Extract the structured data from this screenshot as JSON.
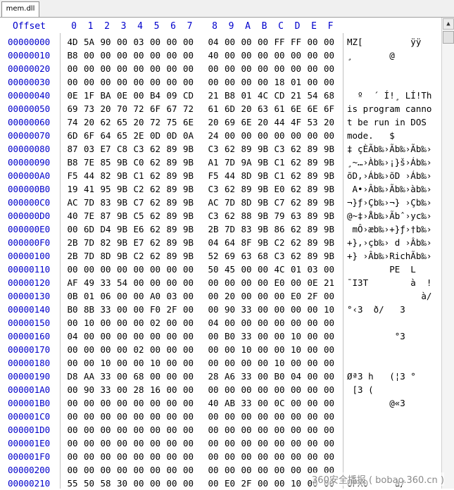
{
  "tab": {
    "label": "mem.dll"
  },
  "header": {
    "offset_label": "Offset",
    "columns": [
      "0",
      "1",
      "2",
      "3",
      "4",
      "5",
      "6",
      "7",
      "8",
      "9",
      "A",
      "B",
      "C",
      "D",
      "E",
      "F"
    ]
  },
  "rows": [
    {
      "offset": "00000000",
      "bytes": [
        "4D",
        "5A",
        "90",
        "00",
        "03",
        "00",
        "00",
        "00",
        "04",
        "00",
        "00",
        "00",
        "FF",
        "FF",
        "00",
        "00"
      ],
      "ascii": "MZ[         ÿÿ"
    },
    {
      "offset": "00000010",
      "bytes": [
        "B8",
        "00",
        "00",
        "00",
        "00",
        "00",
        "00",
        "00",
        "40",
        "00",
        "00",
        "00",
        "00",
        "00",
        "00",
        "00"
      ],
      "ascii": "¸       @"
    },
    {
      "offset": "00000020",
      "bytes": [
        "00",
        "00",
        "00",
        "00",
        "00",
        "00",
        "00",
        "00",
        "00",
        "00",
        "00",
        "00",
        "00",
        "00",
        "00",
        "00"
      ],
      "ascii": ""
    },
    {
      "offset": "00000030",
      "bytes": [
        "00",
        "00",
        "00",
        "00",
        "00",
        "00",
        "00",
        "00",
        "00",
        "00",
        "00",
        "00",
        "18",
        "01",
        "00",
        "00"
      ],
      "ascii": ""
    },
    {
      "offset": "00000040",
      "bytes": [
        "0E",
        "1F",
        "BA",
        "0E",
        "00",
        "B4",
        "09",
        "CD",
        "21",
        "B8",
        "01",
        "4C",
        "CD",
        "21",
        "54",
        "68"
      ],
      "ascii": "  º  ´ Í!¸ LÍ!Th"
    },
    {
      "offset": "00000050",
      "bytes": [
        "69",
        "73",
        "20",
        "70",
        "72",
        "6F",
        "67",
        "72",
        "61",
        "6D",
        "20",
        "63",
        "61",
        "6E",
        "6E",
        "6F"
      ],
      "ascii": "is program canno"
    },
    {
      "offset": "00000060",
      "bytes": [
        "74",
        "20",
        "62",
        "65",
        "20",
        "72",
        "75",
        "6E",
        "20",
        "69",
        "6E",
        "20",
        "44",
        "4F",
        "53",
        "20"
      ],
      "ascii": "t be run in DOS"
    },
    {
      "offset": "00000070",
      "bytes": [
        "6D",
        "6F",
        "64",
        "65",
        "2E",
        "0D",
        "0D",
        "0A",
        "24",
        "00",
        "00",
        "00",
        "00",
        "00",
        "00",
        "00"
      ],
      "ascii": "mode.   $"
    },
    {
      "offset": "00000080",
      "bytes": [
        "87",
        "03",
        "E7",
        "C8",
        "C3",
        "62",
        "89",
        "9B",
        "C3",
        "62",
        "89",
        "9B",
        "C3",
        "62",
        "89",
        "9B"
      ],
      "ascii": "‡ çÈÃb‰›Ãb‰›Ãb‰›"
    },
    {
      "offset": "00000090",
      "bytes": [
        "B8",
        "7E",
        "85",
        "9B",
        "C0",
        "62",
        "89",
        "9B",
        "A1",
        "7D",
        "9A",
        "9B",
        "C1",
        "62",
        "89",
        "9B"
      ],
      "ascii": "¸~…›Àb‰›¡}š›Áb‰›"
    },
    {
      "offset": "000000A0",
      "bytes": [
        "F5",
        "44",
        "82",
        "9B",
        "C1",
        "62",
        "89",
        "9B",
        "F5",
        "44",
        "8D",
        "9B",
        "C1",
        "62",
        "89",
        "9B"
      ],
      "ascii": "õD‚›Áb‰›õD ›Áb‰›"
    },
    {
      "offset": "000000B0",
      "bytes": [
        "19",
        "41",
        "95",
        "9B",
        "C2",
        "62",
        "89",
        "9B",
        "C3",
        "62",
        "89",
        "9B",
        "E0",
        "62",
        "89",
        "9B"
      ],
      "ascii": " A•›Âb‰›Ãb‰›àb‰›"
    },
    {
      "offset": "000000C0",
      "bytes": [
        "AC",
        "7D",
        "83",
        "9B",
        "C7",
        "62",
        "89",
        "9B",
        "AC",
        "7D",
        "8D",
        "9B",
        "C7",
        "62",
        "89",
        "9B"
      ],
      "ascii": "¬}ƒ›Çb‰›¬} ›Çb‰›"
    },
    {
      "offset": "000000D0",
      "bytes": [
        "40",
        "7E",
        "87",
        "9B",
        "C5",
        "62",
        "89",
        "9B",
        "C3",
        "62",
        "88",
        "9B",
        "79",
        "63",
        "89",
        "9B"
      ],
      "ascii": "@~‡›Åb‰›Ãbˆ›yc‰›"
    },
    {
      "offset": "000000E0",
      "bytes": [
        "00",
        "6D",
        "D4",
        "9B",
        "E6",
        "62",
        "89",
        "9B",
        "2B",
        "7D",
        "83",
        "9B",
        "86",
        "62",
        "89",
        "9B"
      ],
      "ascii": " mÔ›æb‰›+}ƒ›†b‰›"
    },
    {
      "offset": "000000F0",
      "bytes": [
        "2B",
        "7D",
        "82",
        "9B",
        "E7",
        "62",
        "89",
        "9B",
        "04",
        "64",
        "8F",
        "9B",
        "C2",
        "62",
        "89",
        "9B"
      ],
      "ascii": "+}‚›çb‰› d ›Âb‰›"
    },
    {
      "offset": "00000100",
      "bytes": [
        "2B",
        "7D",
        "8D",
        "9B",
        "C2",
        "62",
        "89",
        "9B",
        "52",
        "69",
        "63",
        "68",
        "C3",
        "62",
        "89",
        "9B"
      ],
      "ascii": "+} ›Âb‰›RichÃb‰›"
    },
    {
      "offset": "00000110",
      "bytes": [
        "00",
        "00",
        "00",
        "00",
        "00",
        "00",
        "00",
        "00",
        "50",
        "45",
        "00",
        "00",
        "4C",
        "01",
        "03",
        "00"
      ],
      "ascii": "        PE  L"
    },
    {
      "offset": "00000120",
      "bytes": [
        "AF",
        "49",
        "33",
        "54",
        "00",
        "00",
        "00",
        "00",
        "00",
        "00",
        "00",
        "00",
        "E0",
        "00",
        "0E",
        "21"
      ],
      "ascii": "¯I3T        à  !"
    },
    {
      "offset": "00000130",
      "bytes": [
        "0B",
        "01",
        "06",
        "00",
        "00",
        "A0",
        "03",
        "00",
        "00",
        "20",
        "00",
        "00",
        "00",
        "E0",
        "2F",
        "00"
      ],
      "ascii": "              à/"
    },
    {
      "offset": "00000140",
      "bytes": [
        "B0",
        "8B",
        "33",
        "00",
        "00",
        "F0",
        "2F",
        "00",
        "00",
        "90",
        "33",
        "00",
        "00",
        "00",
        "00",
        "10"
      ],
      "ascii": "°‹3  ð/   3"
    },
    {
      "offset": "00000150",
      "bytes": [
        "00",
        "10",
        "00",
        "00",
        "00",
        "02",
        "00",
        "00",
        "04",
        "00",
        "00",
        "00",
        "00",
        "00",
        "00",
        "00"
      ],
      "ascii": ""
    },
    {
      "offset": "00000160",
      "bytes": [
        "04",
        "00",
        "00",
        "00",
        "00",
        "00",
        "00",
        "00",
        "00",
        "B0",
        "33",
        "00",
        "00",
        "10",
        "00",
        "00"
      ],
      "ascii": "         °3"
    },
    {
      "offset": "00000170",
      "bytes": [
        "00",
        "00",
        "00",
        "00",
        "02",
        "00",
        "00",
        "00",
        "00",
        "00",
        "10",
        "00",
        "00",
        "10",
        "00",
        "00"
      ],
      "ascii": ""
    },
    {
      "offset": "00000180",
      "bytes": [
        "00",
        "00",
        "10",
        "00",
        "00",
        "10",
        "00",
        "00",
        "00",
        "00",
        "00",
        "00",
        "10",
        "00",
        "00",
        "00"
      ],
      "ascii": ""
    },
    {
      "offset": "00000190",
      "bytes": [
        "D8",
        "AA",
        "33",
        "00",
        "68",
        "00",
        "00",
        "00",
        "28",
        "A6",
        "33",
        "00",
        "B0",
        "04",
        "00",
        "00"
      ],
      "ascii": "Øª3 h   (¦3 °"
    },
    {
      "offset": "000001A0",
      "bytes": [
        "00",
        "90",
        "33",
        "00",
        "28",
        "16",
        "00",
        "00",
        "00",
        "00",
        "00",
        "00",
        "00",
        "00",
        "00",
        "00"
      ],
      "ascii": " [3 ("
    },
    {
      "offset": "000001B0",
      "bytes": [
        "00",
        "00",
        "00",
        "00",
        "00",
        "00",
        "00",
        "00",
        "40",
        "AB",
        "33",
        "00",
        "0C",
        "00",
        "00",
        "00"
      ],
      "ascii": "        @«3"
    },
    {
      "offset": "000001C0",
      "bytes": [
        "00",
        "00",
        "00",
        "00",
        "00",
        "00",
        "00",
        "00",
        "00",
        "00",
        "00",
        "00",
        "00",
        "00",
        "00",
        "00"
      ],
      "ascii": ""
    },
    {
      "offset": "000001D0",
      "bytes": [
        "00",
        "00",
        "00",
        "00",
        "00",
        "00",
        "00",
        "00",
        "00",
        "00",
        "00",
        "00",
        "00",
        "00",
        "00",
        "00"
      ],
      "ascii": ""
    },
    {
      "offset": "000001E0",
      "bytes": [
        "00",
        "00",
        "00",
        "00",
        "00",
        "00",
        "00",
        "00",
        "00",
        "00",
        "00",
        "00",
        "00",
        "00",
        "00",
        "00"
      ],
      "ascii": ""
    },
    {
      "offset": "000001F0",
      "bytes": [
        "00",
        "00",
        "00",
        "00",
        "00",
        "00",
        "00",
        "00",
        "00",
        "00",
        "00",
        "00",
        "00",
        "00",
        "00",
        "00"
      ],
      "ascii": ""
    },
    {
      "offset": "00000200",
      "bytes": [
        "00",
        "00",
        "00",
        "00",
        "00",
        "00",
        "00",
        "00",
        "00",
        "00",
        "00",
        "00",
        "00",
        "00",
        "00",
        "00"
      ],
      "ascii": ""
    },
    {
      "offset": "00000210",
      "bytes": [
        "55",
        "50",
        "58",
        "30",
        "00",
        "00",
        "00",
        "00",
        "00",
        "E0",
        "2F",
        "00",
        "00",
        "10",
        "00",
        "00"
      ],
      "ascii": "UPX0     à/"
    }
  ],
  "watermark": "360安全播报 ( bobao.360.cn )"
}
